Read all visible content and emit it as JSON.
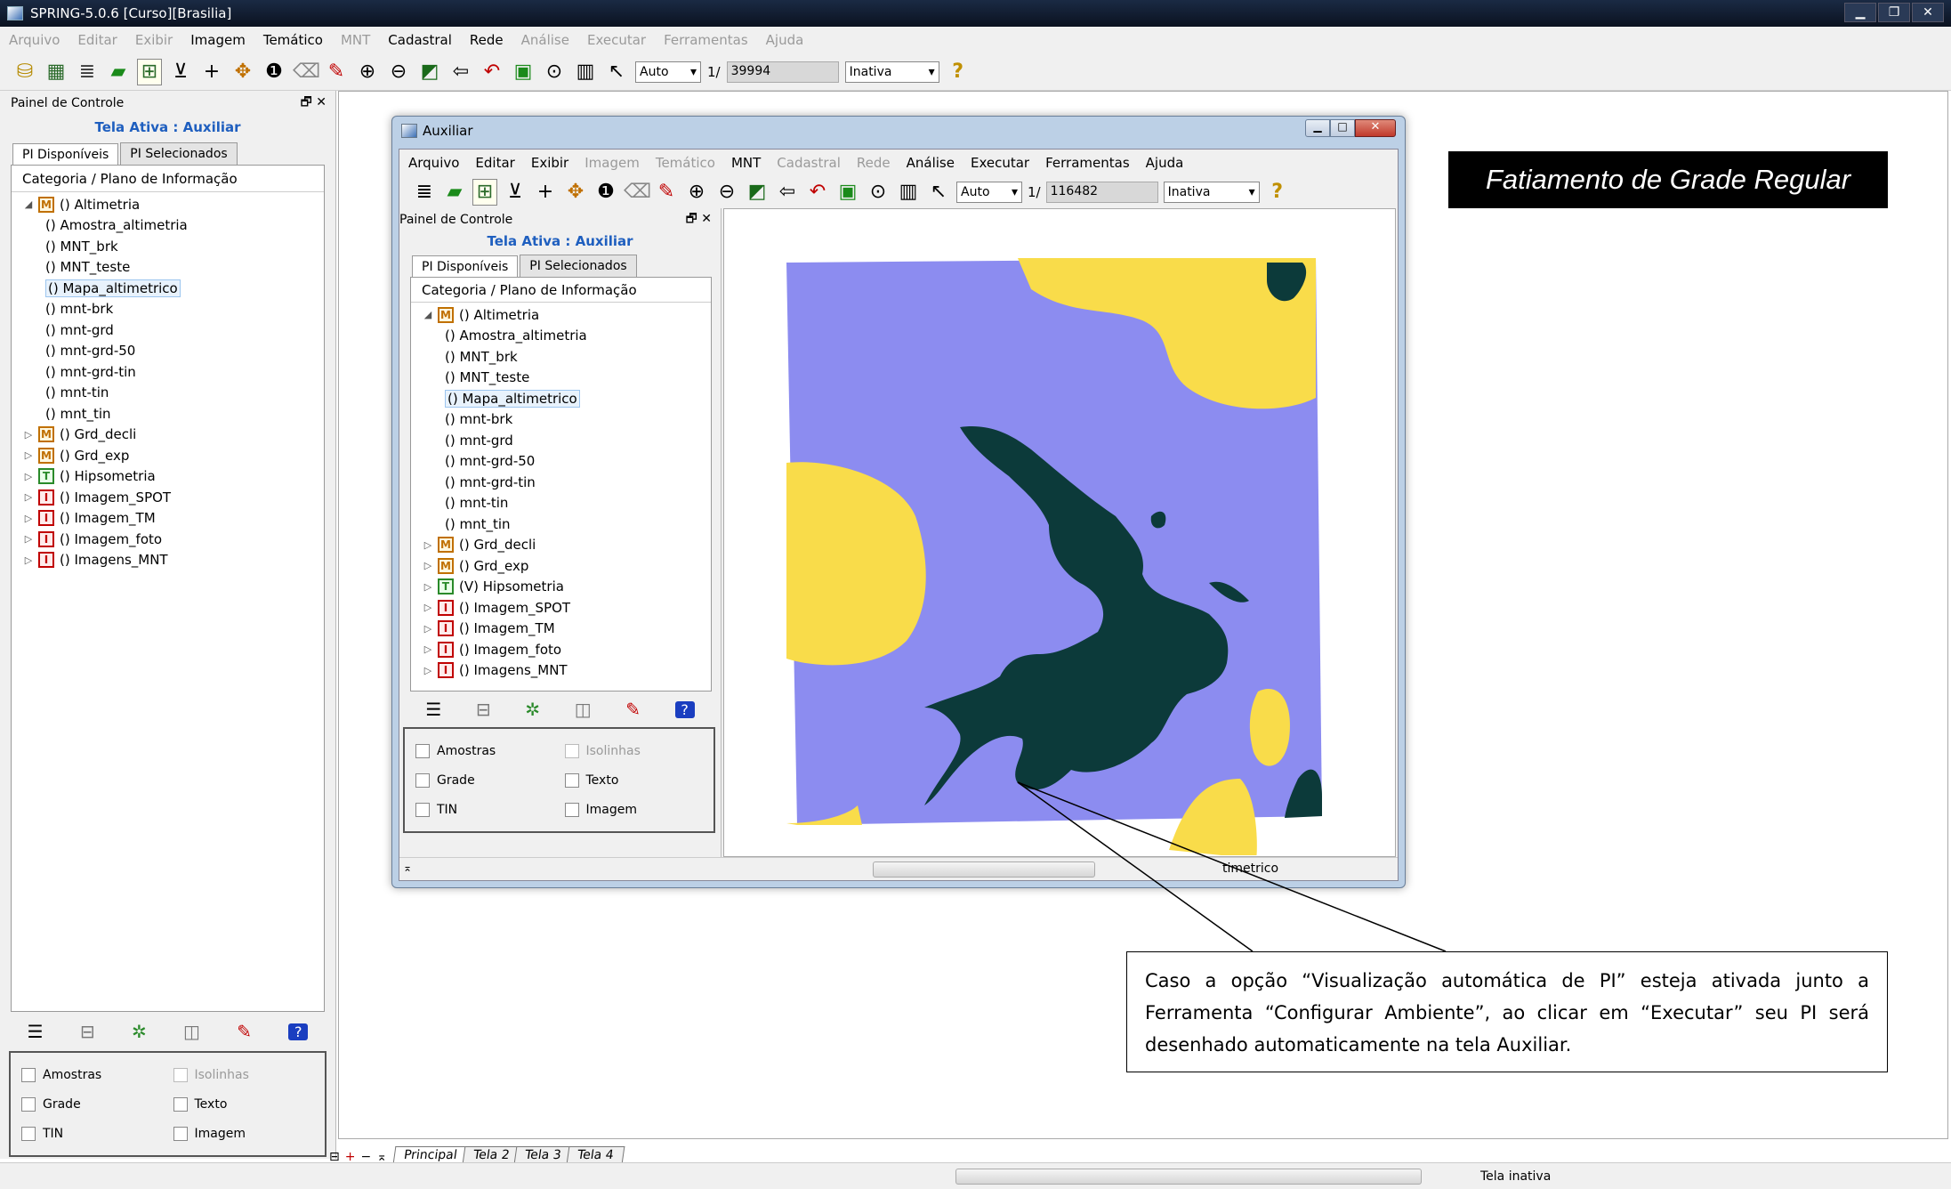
{
  "window": {
    "title": "SPRING-5.0.6 [Curso][Brasilia]",
    "min": "▁",
    "max": "❐",
    "close": "✕"
  },
  "menu": [
    {
      "label": "Arquivo",
      "enabled": false
    },
    {
      "label": "Editar",
      "enabled": false
    },
    {
      "label": "Exibir",
      "enabled": false
    },
    {
      "label": "Imagem",
      "enabled": true
    },
    {
      "label": "Temático",
      "enabled": true
    },
    {
      "label": "MNT",
      "enabled": false
    },
    {
      "label": "Cadastral",
      "enabled": true
    },
    {
      "label": "Rede",
      "enabled": true
    },
    {
      "label": "Análise",
      "enabled": false
    },
    {
      "label": "Executar",
      "enabled": false
    },
    {
      "label": "Ferramentas",
      "enabled": false
    },
    {
      "label": "Ajuda",
      "enabled": false
    }
  ],
  "toolbar": {
    "scale_mode": "Auto",
    "scale_prefix": "1/",
    "scale_value": "39994",
    "state": "Inativa",
    "help": "?"
  },
  "panel": {
    "title": "Painel de Controle",
    "pin": "🗗",
    "close": "✕",
    "active": "Tela Ativa : Auxiliar",
    "tabs": [
      "PI Disponíveis",
      "PI Selecionados"
    ],
    "tree_header": "Categoria / Plano de Informação",
    "tree": [
      {
        "exp": "◢",
        "icon": "M",
        "label": "() Altimetria",
        "indent": 0
      },
      {
        "exp": "",
        "icon": "",
        "label": "() Amostra_altimetria",
        "indent": 1
      },
      {
        "exp": "",
        "icon": "",
        "label": "() MNT_brk",
        "indent": 1
      },
      {
        "exp": "",
        "icon": "",
        "label": "() MNT_teste",
        "indent": 1
      },
      {
        "exp": "",
        "icon": "",
        "label": "() Mapa_altimetrico",
        "indent": 1,
        "selected": true
      },
      {
        "exp": "",
        "icon": "",
        "label": "() mnt-brk",
        "indent": 1
      },
      {
        "exp": "",
        "icon": "",
        "label": "() mnt-grd",
        "indent": 1
      },
      {
        "exp": "",
        "icon": "",
        "label": "() mnt-grd-50",
        "indent": 1
      },
      {
        "exp": "",
        "icon": "",
        "label": "() mnt-grd-tin",
        "indent": 1
      },
      {
        "exp": "",
        "icon": "",
        "label": "() mnt-tin",
        "indent": 1
      },
      {
        "exp": "",
        "icon": "",
        "label": "() mnt_tin",
        "indent": 1
      },
      {
        "exp": "▷",
        "icon": "M",
        "label": "() Grd_decli",
        "indent": 0
      },
      {
        "exp": "▷",
        "icon": "M",
        "label": "() Grd_exp",
        "indent": 0
      },
      {
        "exp": "▷",
        "icon": "T",
        "label": "() Hipsometria",
        "indent": 0
      },
      {
        "exp": "▷",
        "icon": "I",
        "label": "() Imagem_SPOT",
        "indent": 0
      },
      {
        "exp": "▷",
        "icon": "I",
        "label": "() Imagem_TM",
        "indent": 0
      },
      {
        "exp": "▷",
        "icon": "I",
        "label": "() Imagem_foto",
        "indent": 0
      },
      {
        "exp": "▷",
        "icon": "I",
        "label": "() Imagens_MNT",
        "indent": 0
      }
    ],
    "checks": [
      [
        "Amostras",
        "Isolinhas"
      ],
      [
        "Grade",
        "Texto"
      ],
      [
        "TIN",
        "Imagem"
      ]
    ]
  },
  "bottom_tabs": [
    "Principal",
    "Tela 2",
    "Tela 3",
    "Tela 4"
  ],
  "status": "Tela inativa",
  "aux": {
    "title": "Auxiliar",
    "menu": [
      {
        "label": "Arquivo",
        "enabled": true
      },
      {
        "label": "Editar",
        "enabled": true
      },
      {
        "label": "Exibir",
        "enabled": true
      },
      {
        "label": "Imagem",
        "enabled": false
      },
      {
        "label": "Temático",
        "enabled": false
      },
      {
        "label": "MNT",
        "enabled": true
      },
      {
        "label": "Cadastral",
        "enabled": false
      },
      {
        "label": "Rede",
        "enabled": false
      },
      {
        "label": "Análise",
        "enabled": true
      },
      {
        "label": "Executar",
        "enabled": true
      },
      {
        "label": "Ferramentas",
        "enabled": true
      },
      {
        "label": "Ajuda",
        "enabled": true
      }
    ],
    "scale_mode": "Auto",
    "scale_prefix": "1/",
    "scale_value": "116482",
    "state": "Inativa",
    "panel_title": "Painel de Controle",
    "active": "Tela Ativa : Auxiliar",
    "tabs": [
      "PI Disponíveis",
      "PI Selecionados"
    ],
    "tree_header": "Categoria / Plano de Informação",
    "hipsometria_label": "(V) Hipsometria",
    "status_text": "timetrico",
    "map_colors": {
      "low": "#8c8cf0",
      "mid": "#f9dc4a",
      "high": "#0c3a3a"
    }
  },
  "caption": "Fatiamento de Grade Regular",
  "callout": "Caso a opção “Visualização automática de PI” esteja ativada junto a Ferramenta “Configurar Ambiente”, ao clicar em “Executar” seu PI será desenhado automaticamente na tela Auxiliar."
}
